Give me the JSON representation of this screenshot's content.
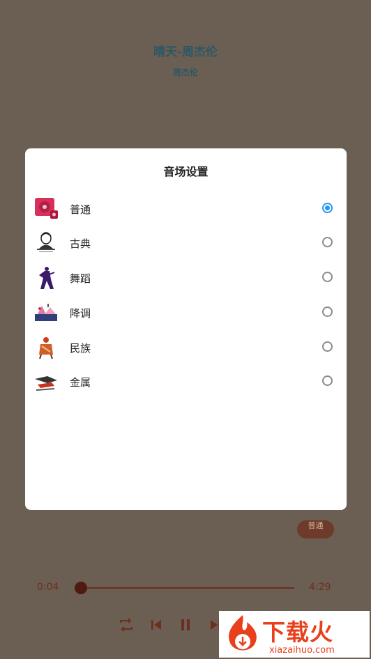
{
  "player": {
    "song_title": "晴天-周杰伦",
    "artist": "周杰伦",
    "mode_badge": "普通",
    "current_time": "0:04",
    "total_time": "4:29",
    "progress": 0.015
  },
  "dialog": {
    "title": "音场设置",
    "options": [
      {
        "label": "普通",
        "icon": "speaker-icon",
        "selected": true
      },
      {
        "label": "古典",
        "icon": "classical-portrait-icon",
        "selected": false
      },
      {
        "label": "舞蹈",
        "icon": "dancer-icon",
        "selected": false
      },
      {
        "label": "降调",
        "icon": "lowered-key-icon",
        "selected": false
      },
      {
        "label": "民族",
        "icon": "folk-figure-icon",
        "selected": false
      },
      {
        "label": "金属",
        "icon": "metal-icon",
        "selected": false
      }
    ]
  },
  "watermark": {
    "brand": "下载火",
    "site": "xiazaihuo.com"
  },
  "colors": {
    "background": "#6b5e52",
    "accent": "#2196f3",
    "player_dark": "#6e2e1e"
  }
}
